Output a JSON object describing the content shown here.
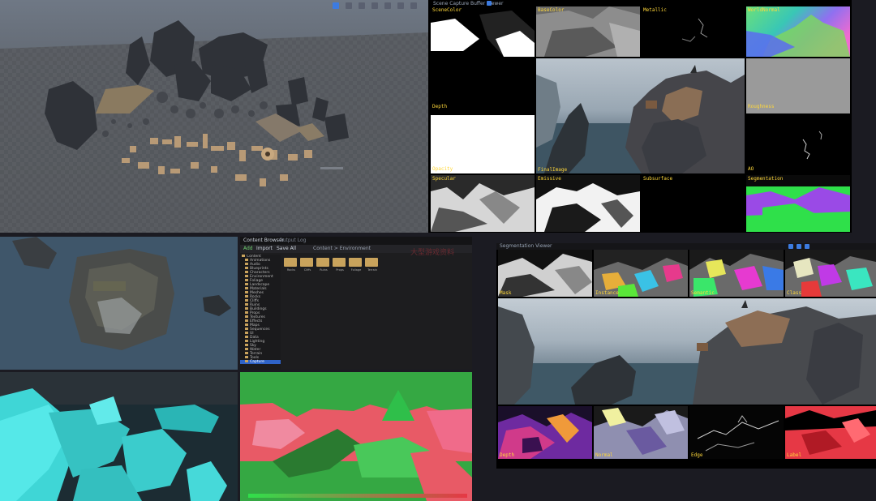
{
  "viewport_top_left": {
    "panel_name": "asset-kit-viewport"
  },
  "gbuffer_top_right": {
    "window_title": "Scene Capture Buffer Viewer",
    "tile_labels": [
      "SceneColor",
      "BaseColor",
      "Metallic",
      "WorldNormal",
      "Depth",
      "FinalImage",
      "Roughness",
      "Opacity",
      "AO",
      "Specular",
      "Emissive",
      "Subsurface",
      "Segmentation"
    ]
  },
  "editor_bottom_left": {
    "content_browser": {
      "tabs": [
        "Content Browser",
        "Output Log"
      ],
      "buttons": [
        "Add",
        "Import",
        "Save All"
      ],
      "path": "Content > Environment",
      "tree_items": [
        "Content",
        "Animations",
        "Audio",
        "Blueprints",
        "Characters",
        "Environment",
        "Foliage",
        "Landscape",
        "Materials",
        "Meshes",
        "Rocks",
        "Cliffs",
        "Ruins",
        "Buildings",
        "Props",
        "Textures",
        "Effects",
        "Maps",
        "Sequences",
        "UI",
        "Data",
        "Lighting",
        "Sky",
        "Water",
        "Terrain",
        "Tools",
        "Capture"
      ],
      "folders": [
        "Rocks",
        "Cliffs",
        "Ruins",
        "Props",
        "Foliage",
        "Terrain"
      ],
      "watermark": "大型游戏资料"
    }
  },
  "segmentation_bottom_right": {
    "window_title": "Segmentation Viewer",
    "top_labels": [
      "Mask",
      "Instance",
      "Semantic",
      "Class"
    ],
    "bottom_labels": [
      "Depth",
      "Normal",
      "Edge",
      "Label"
    ]
  },
  "colors": {
    "background": "#1b1b22",
    "accent": "#3c7be0",
    "label": "#ffd83a",
    "segment_green": "#2fe04a",
    "segment_red": "#e63845",
    "cyan_geometry": "#3fd6d6"
  }
}
